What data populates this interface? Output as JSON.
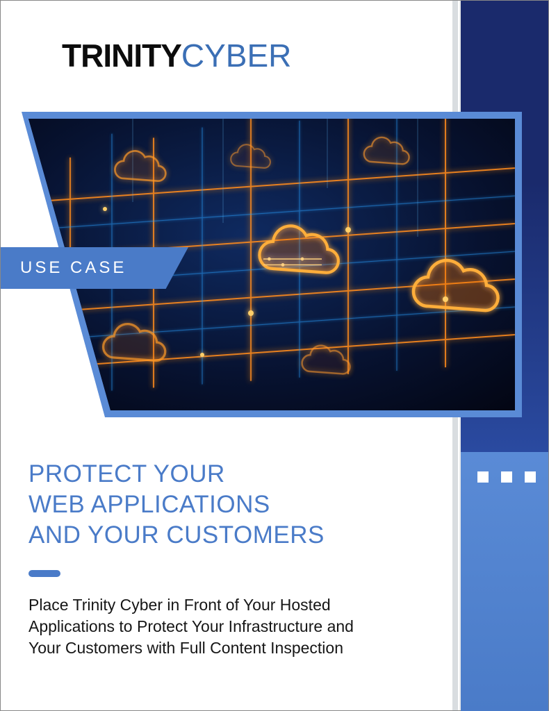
{
  "logo": {
    "part1": "TRINITY",
    "part2": "CYBER"
  },
  "tag": "USE CASE",
  "heading_line1": "PROTECT YOUR",
  "heading_line2": "WEB APPLICATIONS",
  "heading_line3": "AND YOUR CUSTOMERS",
  "body": "Place Trinity Cyber in Front of Your Hosted Applications to Protect Your Infrastructure and Your Customers with Full Content Inspection",
  "colors": {
    "brand_blue": "#4a7bc8",
    "dark_navy": "#1a2a6c",
    "accent_orange": "#ff8c1a",
    "text_black": "#161616"
  }
}
